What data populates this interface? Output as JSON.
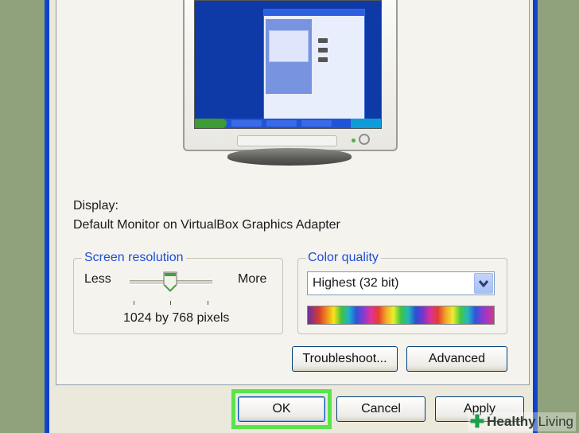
{
  "display": {
    "label": "Display:",
    "device": "Default Monitor on VirtualBox Graphics Adapter"
  },
  "screen_resolution": {
    "group_label": "Screen resolution",
    "less_label": "Less",
    "more_label": "More",
    "value_text": "1024 by 768 pixels"
  },
  "color_quality": {
    "group_label": "Color quality",
    "selected": "Highest (32 bit)"
  },
  "buttons": {
    "troubleshoot": "Troubleshoot...",
    "advanced": "Advanced",
    "ok": "OK",
    "cancel": "Cancel",
    "apply": "Apply"
  },
  "watermark": {
    "brand_bold": "Healthy",
    "brand_rest": "Living"
  },
  "colors": {
    "highlight": "#5ae34a",
    "group_label": "#1d4fd6",
    "window_frame": "#0b3fcf"
  }
}
